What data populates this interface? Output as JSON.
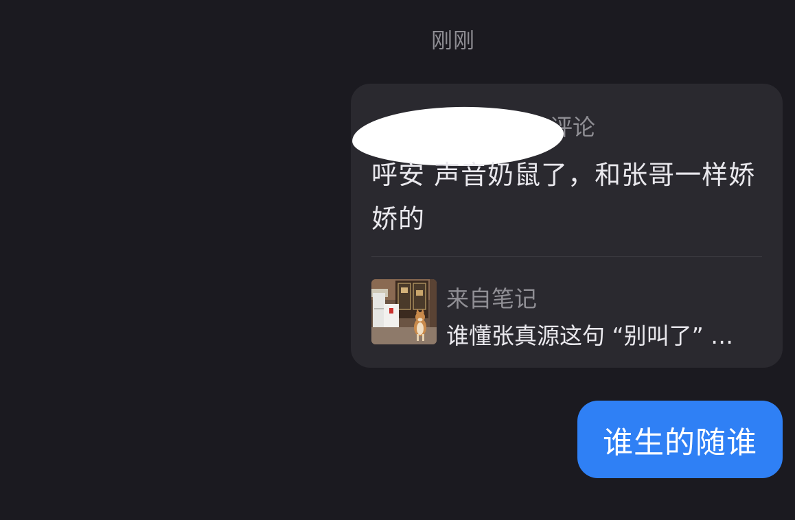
{
  "chat": {
    "timestamp": "刚刚",
    "comment_card": {
      "header_visible_suffix": "评论",
      "body": "呼安 声音奶鼠了，和张哥一样娇娇的",
      "note": {
        "source_label": "来自笔记",
        "title": "谁懂张真源这句 “别叫了” …",
        "thumbnail_icon": "shiba-dog-photo"
      }
    },
    "reply_message": "谁生的随谁"
  },
  "colors": {
    "background": "#1b1a20",
    "card": "#2a292f",
    "reply_bubble": "#2f80f5",
    "muted_text": "#8f8e94",
    "primary_text": "#e9e8ed"
  }
}
